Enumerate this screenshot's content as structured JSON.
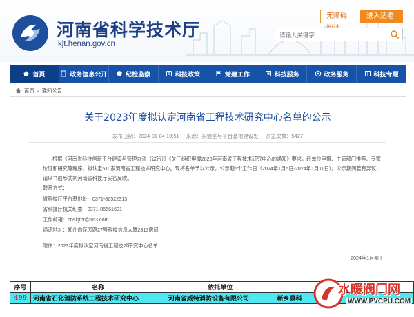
{
  "header": {
    "site_title": "河南省科学技术厅",
    "site_domain": "kjt.henan.gov.cn",
    "btn_barrier_free": "无障碍阅读",
    "btn_elder_mode": "进入适老模式",
    "search_placeholder": "请输入关键字"
  },
  "nav": {
    "items": [
      {
        "label": "首页",
        "icon": "home-icon"
      },
      {
        "label": "政务信息公开",
        "icon": "document-icon"
      },
      {
        "label": "纪检监察",
        "icon": "shield-icon"
      },
      {
        "label": "科技政策",
        "icon": "policy-icon"
      },
      {
        "label": "党建工作",
        "icon": "flag-icon"
      },
      {
        "label": "科技服务",
        "icon": "service-icon"
      },
      {
        "label": "政务服务",
        "icon": "gov-icon"
      },
      {
        "label": "科技专题",
        "icon": "topic-icon"
      }
    ]
  },
  "breadcrumb": {
    "home": "首页",
    "separator": ">",
    "current": "通知公告"
  },
  "article": {
    "title": "关于2023年度拟认定河南省工程技术研究中心名单的公示",
    "publish_time": "发布日期：2024-01-04 10:51",
    "source": "来源：实验室与平台基地建设处",
    "views": "浏览次数：5427",
    "paragraphs": [
      "根据《河南省科技创新平台建设与管理办法（试行）》《关于组织申报2023年河南省工程技术研究中心的通知》要求，经单位申报、主管部门推荐、专家论证和研究等程序，拟认定510家河南省工程技术研究中心。现将名单予以公示，公示期5个工作日（2024年1月5日-2024年1月11日）。公示期间若有异议，请以书面形式向河南省科技厅实名反映。"
    ],
    "contacts": [
      "联系方式：",
      "省科技厅平台基地处　0371-86522313",
      "省科技厅机关纪委　0371-86561631",
      "工作邮箱：hnskjtpt@163.com",
      "通讯地址：郑州市花园路27号科技信息大厦2313房间"
    ],
    "attachment": "附件：2023年度拟认定河南省工程技术研究中心名单",
    "date": "2024年1月4日"
  },
  "table": {
    "headers": [
      "序号",
      "名称",
      "依托单位",
      ""
    ],
    "rows": [
      [
        "499",
        "河南省石化消防系统工程技术研究中心",
        "河南省威特消防设备有限公司",
        "新乡县科"
      ]
    ]
  },
  "watermark": {
    "text": "水暖阀门网",
    "url": "WWW.PVCPU.COM"
  },
  "colors": {
    "nav_bg": "#1552a8",
    "title_blue": "#1f4fa0",
    "highlight": "#4de8f2",
    "orange": "#f08a1c"
  }
}
